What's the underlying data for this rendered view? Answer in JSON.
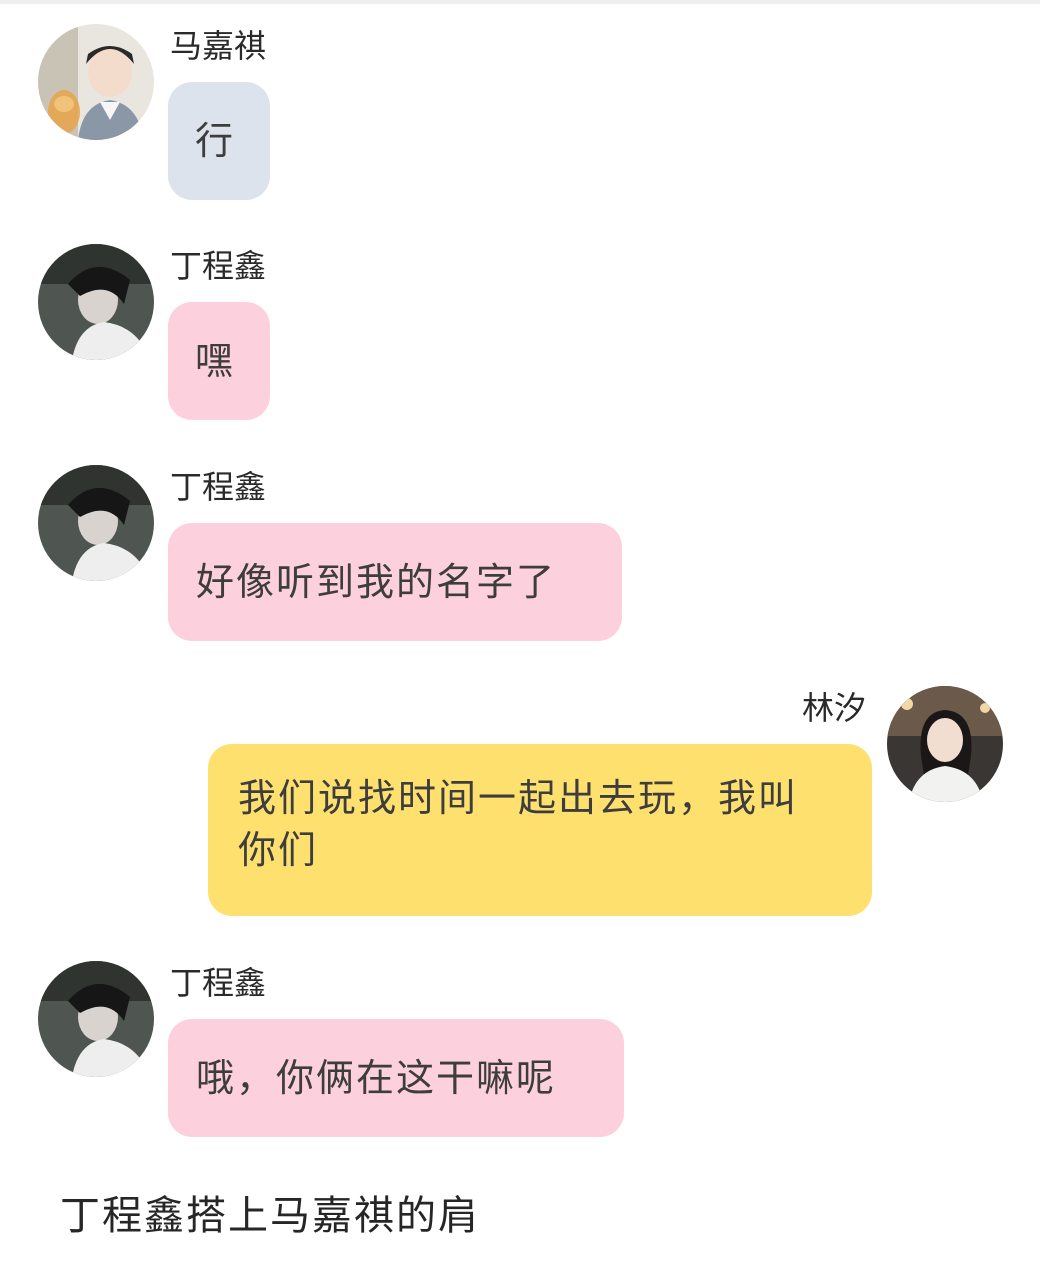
{
  "messages": [
    {
      "sender": "马嘉祺",
      "text": "行",
      "avatar": "avatar-majiaqi-icon",
      "bubble_color": "#dde3ec"
    },
    {
      "sender": "丁程鑫",
      "text": "嘿",
      "avatar": "avatar-dingchengxin-icon",
      "bubble_color": "#fdd0dd"
    },
    {
      "sender": "丁程鑫",
      "text": "好像听到我的名字了",
      "avatar": "avatar-dingchengxin-icon",
      "bubble_color": "#fdd0dd"
    },
    {
      "sender": "林汐",
      "text": "我们说找时间一起出去玩，我叫你们",
      "avatar": "avatar-linxi-icon",
      "bubble_color": "#fde06e"
    },
    {
      "sender": "丁程鑫",
      "text": "哦，你俩在这干嘛呢",
      "avatar": "avatar-dingchengxin-icon",
      "bubble_color": "#fdd0dd"
    }
  ],
  "narration": "丁程鑫搭上马嘉祺的肩"
}
